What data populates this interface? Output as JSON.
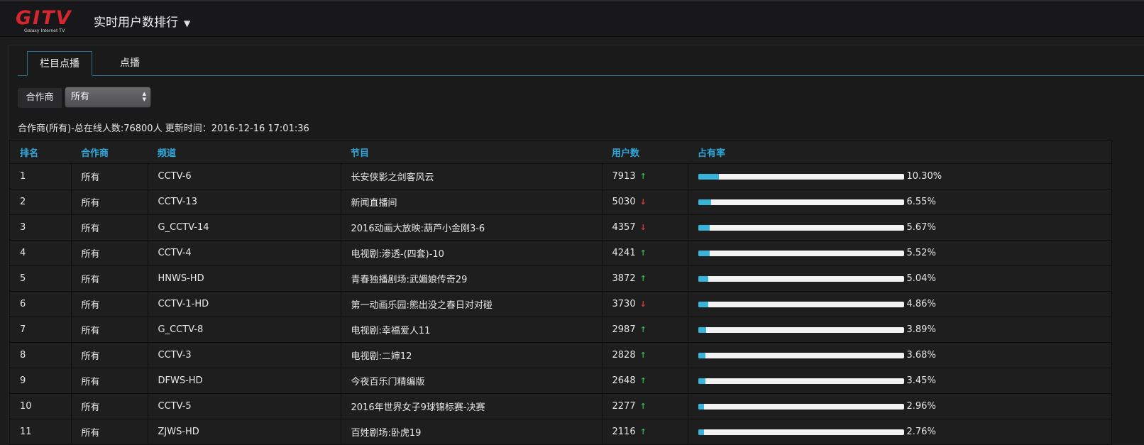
{
  "logo": {
    "wordmark": "GITV",
    "tagline": "Galaxy Internet TV"
  },
  "header": {
    "title": "实时用户数排行"
  },
  "tabs": [
    {
      "label": "栏目点播",
      "active": true
    },
    {
      "label": "点播",
      "active": false
    }
  ],
  "filter": {
    "label": "合作商",
    "selected": "所有"
  },
  "summary": "合作商(所有)-总在线人数:76800人 更新时间：2016-12-16 17:01:36",
  "table": {
    "columns": [
      "排名",
      "合作商",
      "频道",
      "节目",
      "用户数",
      "占有率"
    ],
    "rows": [
      {
        "rank": "1",
        "partner": "所有",
        "channel": "CCTV-6",
        "program": "长安侠影之剑客风云",
        "users": "7913",
        "trend": "up",
        "share": "10.30%",
        "share_value": 10.3
      },
      {
        "rank": "2",
        "partner": "所有",
        "channel": "CCTV-13",
        "program": "新闻直播间",
        "users": "5030",
        "trend": "down",
        "share": "6.55%",
        "share_value": 6.55
      },
      {
        "rank": "3",
        "partner": "所有",
        "channel": "G_CCTV-14",
        "program": "2016动画大放映:葫芦小金刚3-6",
        "users": "4357",
        "trend": "down",
        "share": "5.67%",
        "share_value": 5.67
      },
      {
        "rank": "4",
        "partner": "所有",
        "channel": "CCTV-4",
        "program": "电视剧:渗透-(四套)-10",
        "users": "4241",
        "trend": "up",
        "share": "5.52%",
        "share_value": 5.52
      },
      {
        "rank": "5",
        "partner": "所有",
        "channel": "HNWS-HD",
        "program": "青春独播剧场:武媚娘传奇29",
        "users": "3872",
        "trend": "up",
        "share": "5.04%",
        "share_value": 5.04
      },
      {
        "rank": "6",
        "partner": "所有",
        "channel": "CCTV-1-HD",
        "program": "第一动画乐园:熊出没之春日对对碰",
        "users": "3730",
        "trend": "down",
        "share": "4.86%",
        "share_value": 4.86
      },
      {
        "rank": "7",
        "partner": "所有",
        "channel": "G_CCTV-8",
        "program": "电视剧:幸福爱人11",
        "users": "2987",
        "trend": "up",
        "share": "3.89%",
        "share_value": 3.89
      },
      {
        "rank": "8",
        "partner": "所有",
        "channel": "CCTV-3",
        "program": "电视剧:二婶12",
        "users": "2828",
        "trend": "up",
        "share": "3.68%",
        "share_value": 3.68
      },
      {
        "rank": "9",
        "partner": "所有",
        "channel": "DFWS-HD",
        "program": "今夜百乐门精编版",
        "users": "2648",
        "trend": "up",
        "share": "3.45%",
        "share_value": 3.45
      },
      {
        "rank": "10",
        "partner": "所有",
        "channel": "CCTV-5",
        "program": "2016年世界女子9球锦标赛-决赛",
        "users": "2277",
        "trend": "up",
        "share": "2.96%",
        "share_value": 2.96
      },
      {
        "rank": "11",
        "partner": "所有",
        "channel": "ZJWS-HD",
        "program": "百姓剧场:卧虎19",
        "users": "2116",
        "trend": "up",
        "share": "2.76%",
        "share_value": 2.76
      }
    ]
  },
  "colors": {
    "accent": "#2ea8da",
    "bar_fill": "#39b3d8",
    "up": "#36b35a",
    "down": "#d43b3b",
    "logo": "#d8262e"
  },
  "icons": {
    "up": "arrow-up-icon",
    "down": "arrow-down-icon",
    "dropdown": "caret-down-icon"
  }
}
